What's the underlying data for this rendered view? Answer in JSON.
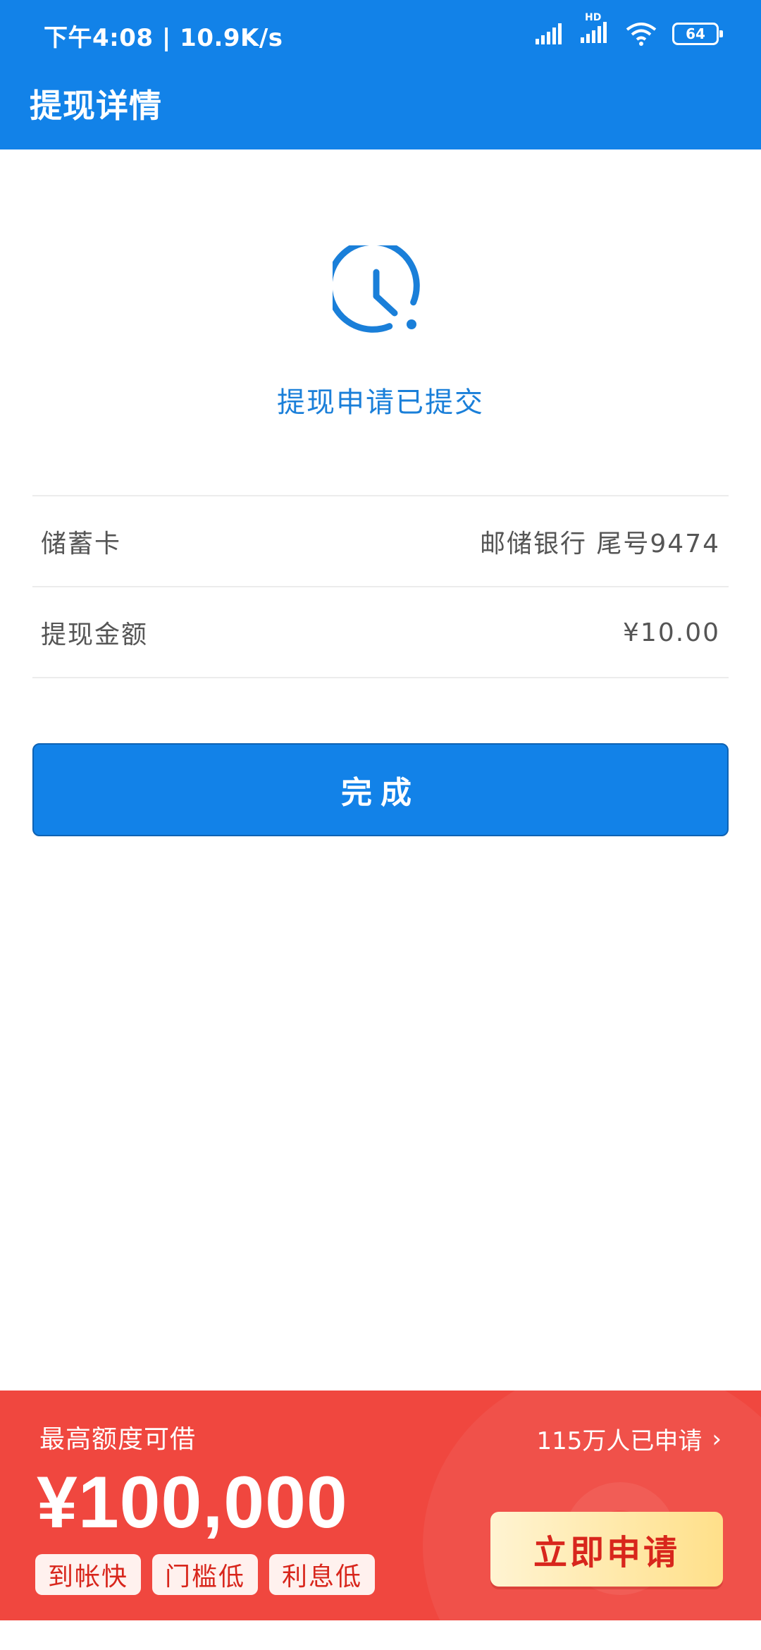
{
  "status_bar": {
    "time": "下午4:08 | 10.9K/s",
    "hd": "HD",
    "battery": "64"
  },
  "header": {
    "title": "提现详情"
  },
  "status": {
    "message": "提现申请已提交"
  },
  "rows": [
    {
      "label": "储蓄卡",
      "value": "邮储银行 尾号9474"
    },
    {
      "label": "提现金额",
      "value": "¥10.00"
    }
  ],
  "done_button": {
    "label": "完成"
  },
  "promo": {
    "label": "最高额度可借",
    "count": "115万人已申请",
    "amount": "¥100,000",
    "tags": [
      "到帐快",
      "门槛低",
      "利息低"
    ],
    "apply_label": "立即申请"
  },
  "colors": {
    "primary": "#1282e8",
    "promo": "#f0473f",
    "tag_text": "#d8261c"
  }
}
